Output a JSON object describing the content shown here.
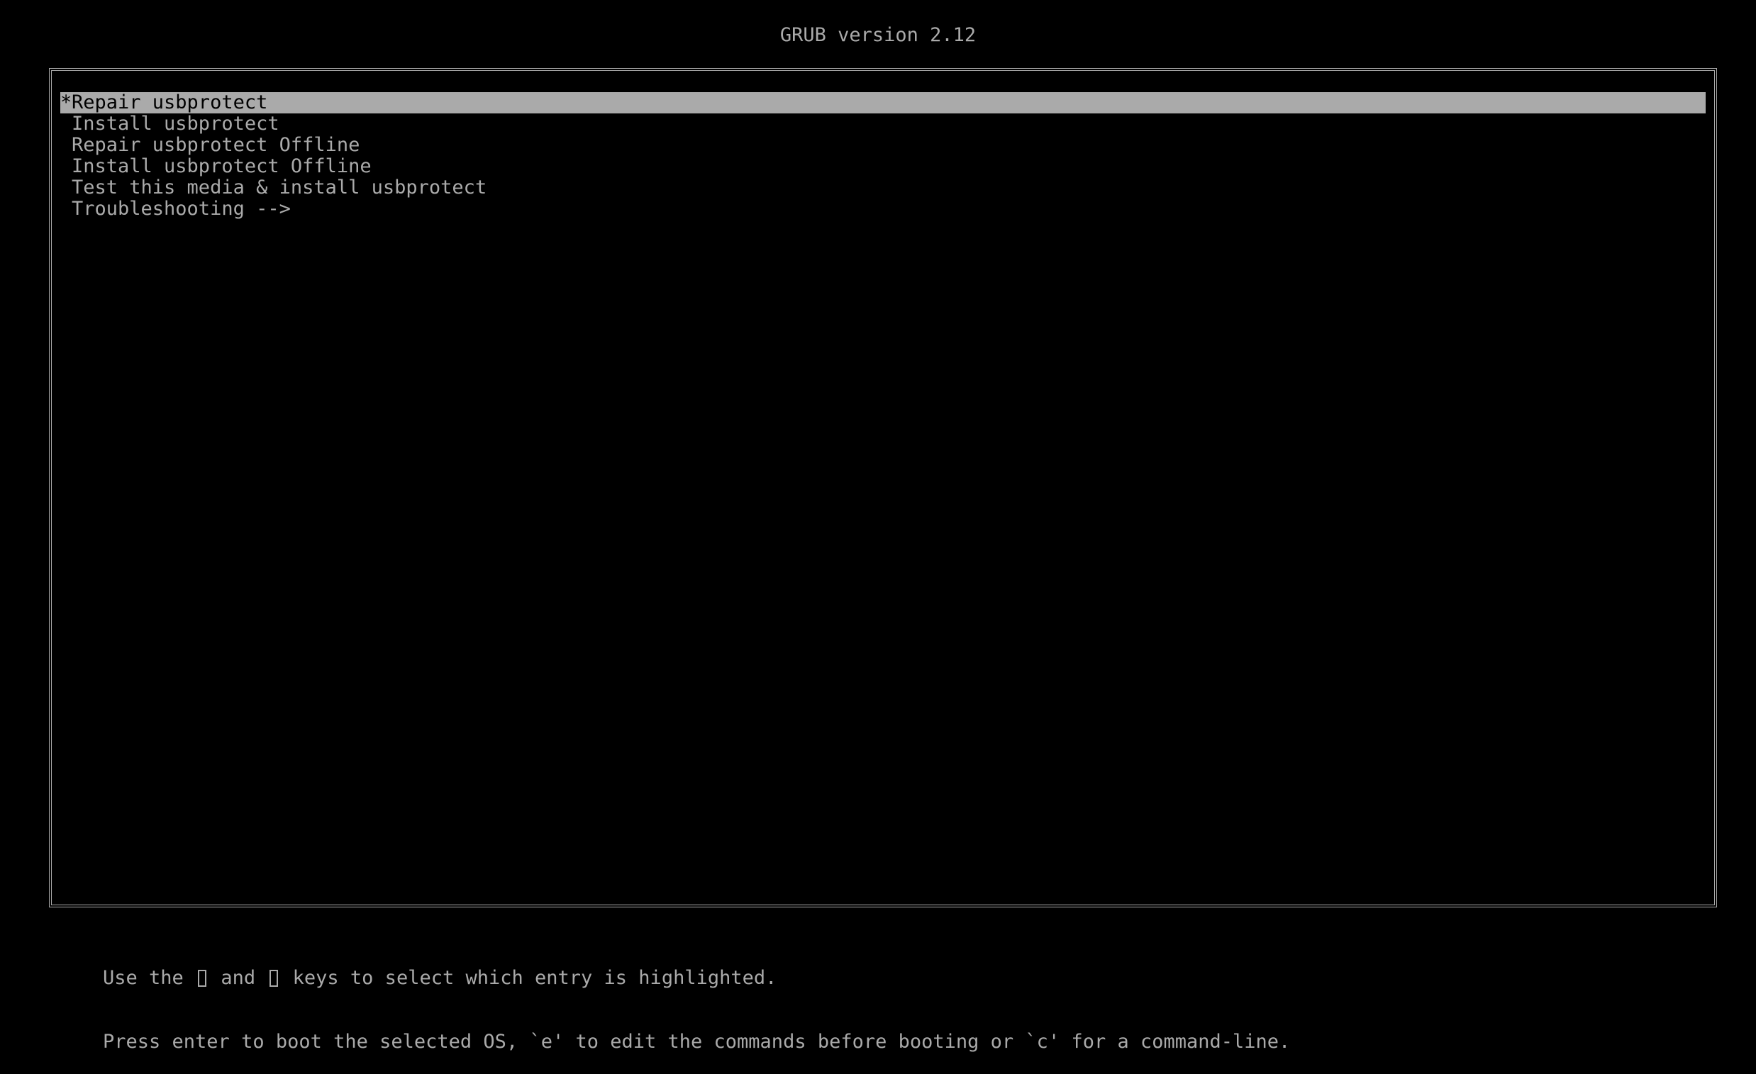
{
  "header": {
    "title": "GRUB version 2.12"
  },
  "menu": {
    "selected_marker": "*",
    "entries": [
      {
        "label": "Repair usbprotect",
        "selected": true
      },
      {
        "label": "Install usbprotect",
        "selected": false
      },
      {
        "label": "Repair usbprotect Offline",
        "selected": false
      },
      {
        "label": "Install usbprotect Offline",
        "selected": false
      },
      {
        "label": "Test this media & install usbprotect",
        "selected": false
      },
      {
        "label": "Troubleshooting -->",
        "selected": false
      }
    ]
  },
  "footer": {
    "line1_part1": "Use the",
    "line1_part2": "and",
    "line1_part3": "keys to select which entry is highlighted.",
    "line2": "Press enter to boot the selected OS, `e' to edit the commands before booting or `c' for a command-line."
  },
  "colors": {
    "background": "#000000",
    "text": "#aaaaaa",
    "highlight_bg": "#aaaaaa",
    "highlight_text": "#000000"
  }
}
